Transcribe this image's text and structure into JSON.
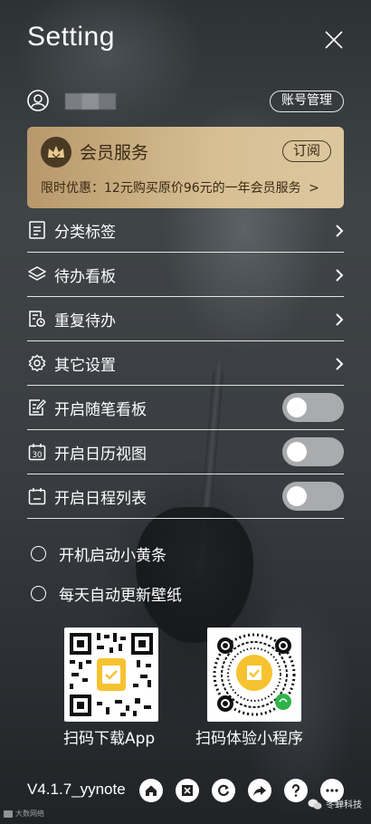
{
  "window": {
    "title": "Setting"
  },
  "user": {
    "account_button": "账号管理"
  },
  "vip": {
    "title": "会员服务",
    "subscribe_button": "订阅",
    "promo": "限时优惠：12元购买原价96元的一年会员服务",
    "promo_arrow": ">",
    "colors": {
      "gradient_start": "#b7986c",
      "gradient_end": "#dcc79f",
      "text": "#3a2a14"
    }
  },
  "menu": {
    "items": [
      {
        "label": "分类标签",
        "icon": "list-doc-icon",
        "control": "chevron"
      },
      {
        "label": "待办看板",
        "icon": "layers-icon",
        "control": "chevron"
      },
      {
        "label": "重复待办",
        "icon": "repeat-doc-icon",
        "control": "chevron"
      },
      {
        "label": "其它设置",
        "icon": "gear-icon",
        "control": "chevron"
      },
      {
        "label": "开启随笔看板",
        "icon": "edit-note-icon",
        "control": "toggle",
        "enabled": false
      },
      {
        "label": "开启日历视图",
        "icon": "calendar-30-icon",
        "calendar_number": "30",
        "control": "toggle",
        "enabled": false
      },
      {
        "label": "开启日程列表",
        "icon": "calendar-list-icon",
        "control": "toggle",
        "enabled": false
      }
    ]
  },
  "options": [
    {
      "label": "开机启动小黄条",
      "checked": false
    },
    {
      "label": "每天自动更新壁纸",
      "checked": false
    }
  ],
  "qrcodes": [
    {
      "label": "扫码下载App"
    },
    {
      "label": "扫码体验小程序"
    }
  ],
  "footer": {
    "version": "V4.1.7_yynote",
    "buttons": [
      "home-icon",
      "excel-icon",
      "refresh-icon",
      "share-icon",
      "help-icon",
      "more-icon"
    ]
  },
  "watermarks": {
    "left": "大数网络",
    "right": "冬蝉科技"
  }
}
